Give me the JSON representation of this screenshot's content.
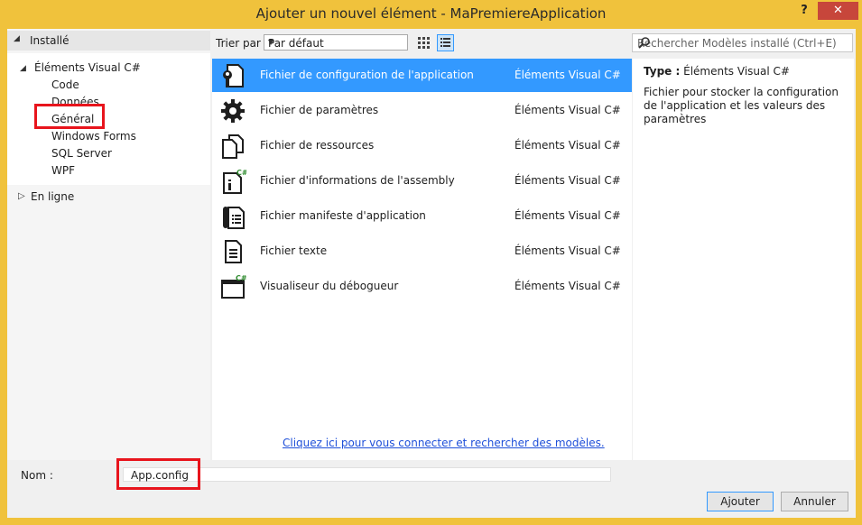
{
  "window": {
    "title": "Ajouter un nouvel élément - MaPremiereApplication",
    "help_label": "?",
    "close_label": "✕"
  },
  "tree": {
    "installed": "Installé",
    "visual_csharp": "Éléments Visual C#",
    "children": [
      "Code",
      "Données",
      "Général",
      "Windows Forms",
      "SQL Server",
      "WPF"
    ],
    "online": "En ligne"
  },
  "toolbar": {
    "sort_label": "Trier par :",
    "sort_value": "Par défaut"
  },
  "search": {
    "placeholder": "Rechercher Modèles installé (Ctrl+E)"
  },
  "items": [
    {
      "name": "Fichier de configuration de l'application",
      "category": "Éléments Visual C#",
      "icon": "config-file-icon",
      "selected": true
    },
    {
      "name": "Fichier de paramètres",
      "category": "Éléments Visual C#",
      "icon": "settings-gear-icon"
    },
    {
      "name": "Fichier de ressources",
      "category": "Éléments Visual C#",
      "icon": "resource-file-icon"
    },
    {
      "name": "Fichier d'informations de l'assembly",
      "category": "Éléments Visual C#",
      "icon": "assembly-info-icon"
    },
    {
      "name": "Fichier manifeste d'application",
      "category": "Éléments Visual C#",
      "icon": "manifest-file-icon"
    },
    {
      "name": "Fichier texte",
      "category": "Éléments Visual C#",
      "icon": "text-file-icon"
    },
    {
      "name": "Visualiseur du débogueur",
      "category": "Éléments Visual C#",
      "icon": "debugger-visualizer-icon"
    }
  ],
  "online_link": "Cliquez ici pour vous connecter et rechercher des modèles.",
  "details": {
    "type_label": "Type :",
    "type_value": "Éléments Visual C#",
    "description": "Fichier pour stocker la configuration de l'application et les valeurs des paramètres"
  },
  "name_field": {
    "label": "Nom :",
    "value": "App.config"
  },
  "buttons": {
    "add": "Ajouter",
    "cancel": "Annuler"
  },
  "colors": {
    "frame": "#f0c23c",
    "selection": "#3399ff",
    "highlight_box": "#e8141c",
    "close": "#c7463b"
  }
}
